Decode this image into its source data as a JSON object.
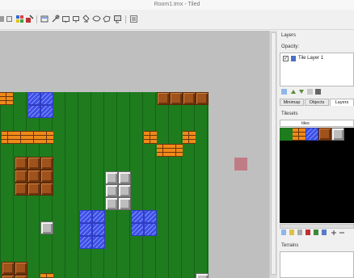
{
  "window": {
    "title": "Room1.tmx - Tiled"
  },
  "toolbar": {
    "icons": [
      "new-icon",
      "open-icon",
      "save-icon",
      "stamp-brush-icon",
      "terrain-brush-icon",
      "bucket-fill-icon",
      "eraser-icon",
      "rectangle-select-icon",
      "magic-wand-icon",
      "select-same-tile-icon",
      "object-select-icon",
      "edit-polygons-icon",
      "insert-rectangle-icon",
      "insert-tile-icon"
    ]
  },
  "map": {
    "tile_kinds": [
      "grass",
      "brick",
      "water",
      "wood",
      "steel"
    ]
  },
  "layers_panel": {
    "title": "Layers",
    "opacity_label": "Opacity:",
    "layer_name": "Tile Layer 1",
    "layer_visible": true
  },
  "tabs": {
    "minimap": "Minimap",
    "objects": "Objects",
    "layers": "Layers"
  },
  "tilesets_panel": {
    "title": "Tilesets",
    "tileset_tab": "tiles"
  },
  "terrains_panel": {
    "title": "Terrains"
  },
  "colors": {
    "grass": "#1e7c1e",
    "brick": "#f08a18",
    "water": "#3c4fe6",
    "wood": "#a0521c",
    "steel": "#bdbdbd"
  }
}
